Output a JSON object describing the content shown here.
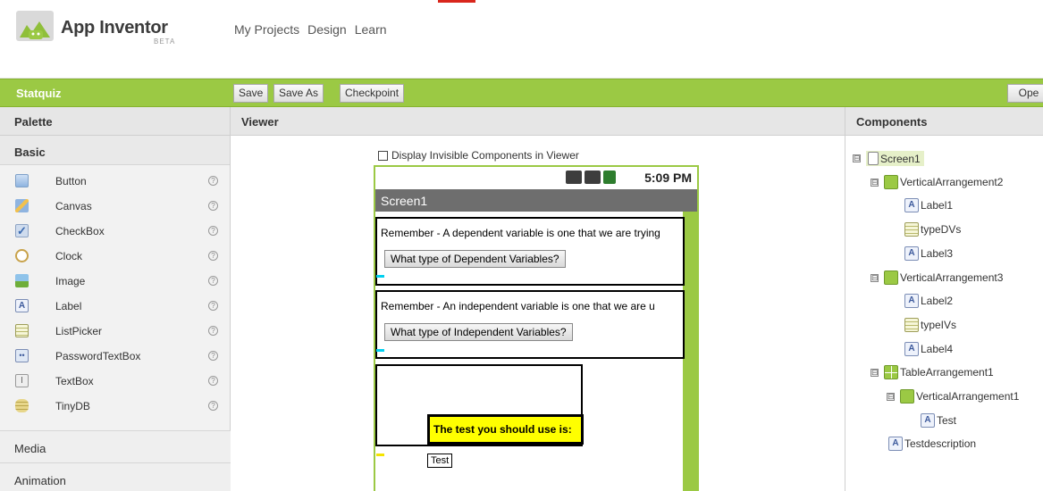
{
  "header": {
    "brand": "App Inventor",
    "beta": "BETA",
    "nav": [
      "My Projects",
      "Design",
      "Learn"
    ]
  },
  "projectbar": {
    "project_name": "Statquiz",
    "save": "Save",
    "save_as": "Save As",
    "checkpoint": "Checkpoint",
    "open_blocks": "Ope"
  },
  "palette": {
    "title": "Palette",
    "basic": "Basic",
    "items": [
      {
        "label": "Button",
        "icon": "button-icon"
      },
      {
        "label": "Canvas",
        "icon": "canvas-icon"
      },
      {
        "label": "CheckBox",
        "icon": "checkbox-icon"
      },
      {
        "label": "Clock",
        "icon": "clock-icon"
      },
      {
        "label": "Image",
        "icon": "image-icon"
      },
      {
        "label": "Label",
        "icon": "label-icon"
      },
      {
        "label": "ListPicker",
        "icon": "listpicker-icon"
      },
      {
        "label": "PasswordTextBox",
        "icon": "password-icon"
      },
      {
        "label": "TextBox",
        "icon": "textbox-icon"
      },
      {
        "label": "TinyDB",
        "icon": "tinydb-icon"
      }
    ],
    "help_glyph": "?",
    "media": "Media",
    "animation": "Animation"
  },
  "viewer": {
    "title": "Viewer",
    "display_invisible": "Display Invisible Components in Viewer",
    "time": "5:09 PM",
    "screen_title": "Screen1",
    "dep_text": "Remember - A dependent variable is one that we are trying",
    "dep_button": "What type of Dependent Variables?",
    "ind_text": "Remember - An independent variable is one that we are u",
    "ind_button": "What type of Independent Variables?",
    "test_heading": "The test you should use is:",
    "test_label": "Test"
  },
  "components": {
    "title": "Components",
    "collapse_glyph": "⊟",
    "tree": {
      "screen": "Screen1",
      "va2": "VerticalArrangement2",
      "label1": "Label1",
      "typedvs": "typeDVs",
      "label3": "Label3",
      "va3": "VerticalArrangement3",
      "label2": "Label2",
      "typeivs": "typeIVs",
      "label4": "Label4",
      "ta1": "TableArrangement1",
      "va1": "VerticalArrangement1",
      "test": "Test",
      "testdesc": "Testdescription"
    }
  },
  "colors": {
    "green": "#9bc944",
    "titlebar": "#6e6e6e",
    "highlight": "#ffff00"
  }
}
